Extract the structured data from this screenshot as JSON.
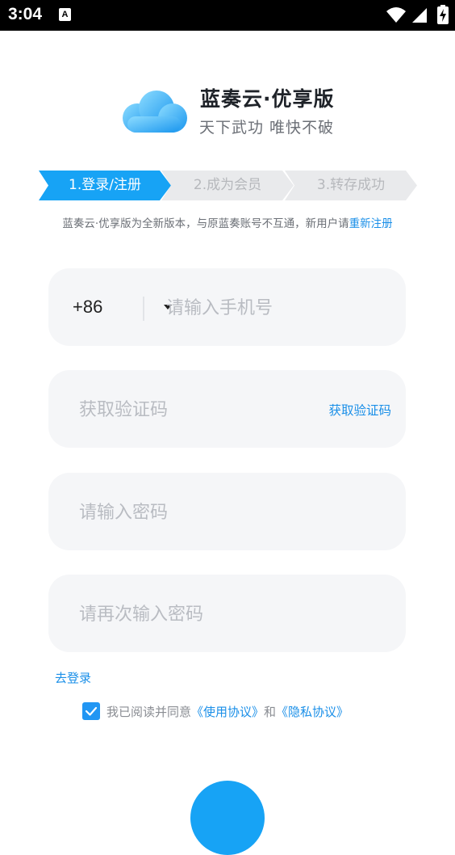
{
  "status_bar": {
    "time": "3:04",
    "notification_icon": "A"
  },
  "logo": {
    "title": "蓝奏云·优享版",
    "slogan": "天下武功 唯快不破",
    "icon": "cloud-icon",
    "colors": {
      "cloud_light": "#7fd4ff",
      "cloud_dark": "#1da1f2"
    }
  },
  "steps": [
    {
      "label": "1.登录/注册",
      "active": true
    },
    {
      "label": "2.成为会员",
      "active": false
    },
    {
      "label": "3.转存成功",
      "active": false
    }
  ],
  "notice": {
    "text": "蓝奏云·优享版为全新版本，与原蓝奏账号不互通，新用户请",
    "link": "重新注册"
  },
  "form": {
    "phone": {
      "country_code": "+86",
      "placeholder": "请输入手机号",
      "value": ""
    },
    "code": {
      "placeholder": "获取验证码",
      "value": "",
      "button": "获取验证码"
    },
    "password": {
      "placeholder": "请输入密码",
      "value": ""
    },
    "password_confirm": {
      "placeholder": "请再次输入密码",
      "value": ""
    }
  },
  "go_login": "去登录",
  "agreement": {
    "checked": true,
    "prefix": "我已阅读并同意",
    "terms": "《使用协议》",
    "and": "和",
    "privacy": "《隐私协议》"
  },
  "colors": {
    "accent": "#1a8fe8",
    "step_active": "#17a3f5",
    "step_inactive": "#e9eaec",
    "field_bg": "#f5f6f8",
    "submit": "#17a3f5"
  }
}
